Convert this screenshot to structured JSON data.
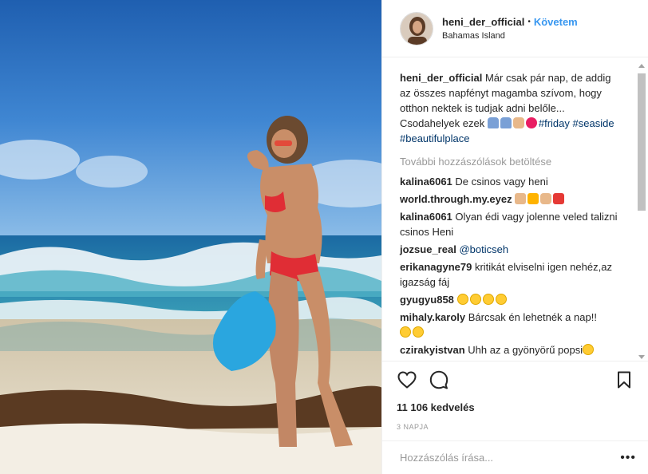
{
  "post": {
    "photo_alt": "Woman in red bikini on a beach"
  },
  "header": {
    "username": "heni_der_official",
    "separator": "•",
    "follow_label": "Követem",
    "location": "Bahamas Island"
  },
  "caption": {
    "username": "heni_der_official",
    "text": "Már csak pár nap, de addig az összes napfényt magamba szívom, hogy otthon nektek is tudjak adni belőle... Csodahelyek ezek",
    "tags": [
      "#friday",
      "#seaside",
      "#beautifulplace"
    ]
  },
  "load_more_label": "További hozzászólások betöltése",
  "comments": [
    {
      "user": "kalina6061",
      "text": "De csinos vagy heni",
      "emojis": []
    },
    {
      "user": "world.through.my.eyez",
      "text": "",
      "emojis": [
        "hand",
        "boom",
        "muscle",
        "anger"
      ]
    },
    {
      "user": "kalina6061",
      "text": "Olyan édi vagy jolenne veled talizni csinos Heni",
      "emojis": []
    },
    {
      "user": "jozsue_real",
      "text": "",
      "mention": "@boticseh",
      "emojis": []
    },
    {
      "user": "erikanagyne79",
      "text": "kritikát elviselni igen nehéz,az igazság fáj",
      "emojis": []
    },
    {
      "user": "gyugyu858",
      "text": "",
      "emojis": [
        "smile",
        "smile",
        "smile",
        "heart"
      ]
    },
    {
      "user": "mihaly.karoly",
      "text": "Bárcsak én lehetnék a nap!!",
      "emojis": [
        "smile",
        "cool"
      ]
    },
    {
      "user": "czirakyistvan",
      "text": "Uhh az a gyönyörű popsi",
      "emojis": [
        "heart"
      ]
    }
  ],
  "actions": {
    "like_icon": "heart-outline-icon",
    "comment_icon": "speech-bubble-icon",
    "save_icon": "bookmark-icon"
  },
  "likes_label": "11 106 kedvelés",
  "time_ago": "3 NAPJA",
  "add_comment": {
    "placeholder": "Hozzászólás írása...",
    "more_icon": "more-options-icon"
  }
}
